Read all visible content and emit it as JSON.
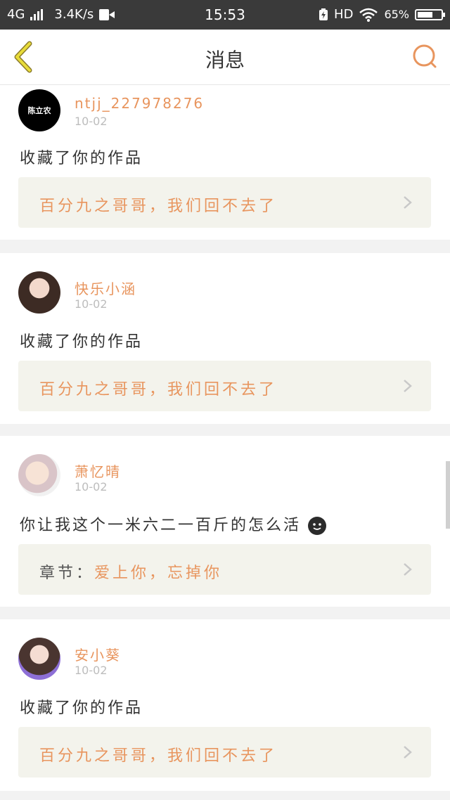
{
  "status_bar": {
    "network": "4G",
    "speed": "3.4K/s",
    "time": "15:53",
    "hd": "HD",
    "battery": "65%",
    "battery_level": 0.65
  },
  "header": {
    "title": "消息",
    "back_icon": "chevron-left-icon",
    "search_icon": "search-icon",
    "accent": "#e8955e"
  },
  "messages": [
    {
      "avatar_text": "陈立农",
      "user": "ntjj_227978276",
      "date": "10-02",
      "action": "收藏了你的作品",
      "ref_prefix": "",
      "ref_text": "百分九之哥哥，我们回不去了"
    },
    {
      "avatar_text": "",
      "user": "快乐小涵",
      "date": "10-02",
      "action": "收藏了你的作品",
      "ref_prefix": "",
      "ref_text": "百分九之哥哥，我们回不去了"
    },
    {
      "avatar_text": "",
      "user": "萧忆晴",
      "date": "10-02",
      "action": "你让我这个一米六二一百斤的怎么活",
      "ref_prefix": "章节：",
      "ref_text": "爱上你，忘掉你"
    },
    {
      "avatar_text": "",
      "user": "安小葵",
      "date": "10-02",
      "action": "收藏了你的作品",
      "ref_prefix": "",
      "ref_text": "百分九之哥哥，我们回不去了"
    }
  ]
}
